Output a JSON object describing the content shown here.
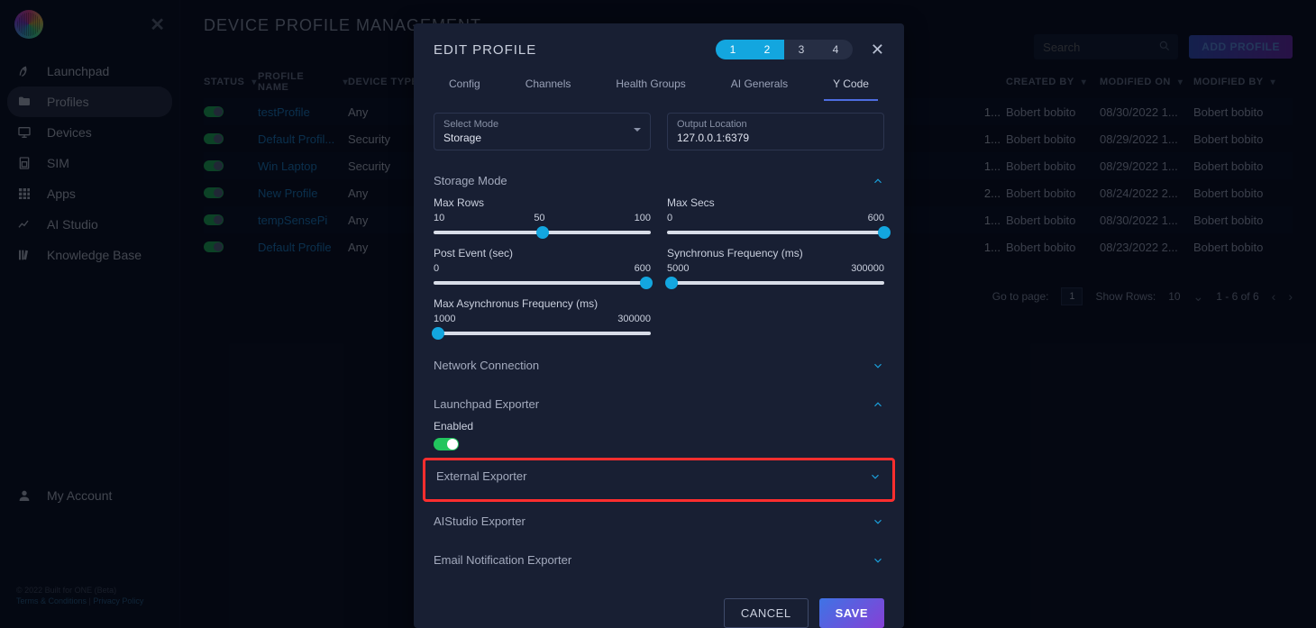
{
  "sidebar": {
    "items": [
      {
        "label": "Launchpad",
        "icon": "rocket-icon"
      },
      {
        "label": "Profiles",
        "icon": "folder-icon",
        "active": true
      },
      {
        "label": "Devices",
        "icon": "monitor-icon"
      },
      {
        "label": "SIM",
        "icon": "sim-icon"
      },
      {
        "label": "Apps",
        "icon": "grid-icon"
      },
      {
        "label": "AI Studio",
        "icon": "analytics-icon"
      },
      {
        "label": "Knowledge Base",
        "icon": "library-icon"
      }
    ],
    "account_label": "My Account",
    "footer_line1": "© 2022 Built for ONE (Beta)",
    "footer_terms": "Terms & Conditions",
    "footer_sep": " | ",
    "footer_privacy": "Privacy Policy"
  },
  "page": {
    "title": "DEVICE PROFILE MANAGEMENT",
    "search_placeholder": "Search",
    "add_profile_label": "ADD PROFILE"
  },
  "table": {
    "columns": {
      "status": "STATUS",
      "profile_name": "PROFILE NAME",
      "device_type": "DEVICE TYPE",
      "created_by": "CREATED BY",
      "modified_on": "MODIFIED ON",
      "modified_by": "MODIFIED BY"
    },
    "rows": [
      {
        "name": "testProfile",
        "device_type": "Any",
        "created_by": "Bobert bobito",
        "modified_on": "08/30/2022 1...",
        "modified_by": "Bobert bobito",
        "short": "1..."
      },
      {
        "name": "Default Profil...",
        "device_type": "Security",
        "created_by": "Bobert bobito",
        "modified_on": "08/29/2022 1...",
        "modified_by": "Bobert bobito",
        "short": "1..."
      },
      {
        "name": "Win Laptop",
        "device_type": "Security",
        "created_by": "Bobert bobito",
        "modified_on": "08/29/2022 1...",
        "modified_by": "Bobert bobito",
        "short": "1..."
      },
      {
        "name": "New Profile",
        "device_type": "Any",
        "created_by": "Bobert bobito",
        "modified_on": "08/24/2022 2...",
        "modified_by": "Bobert bobito",
        "short": "2..."
      },
      {
        "name": "tempSensePi",
        "device_type": "Any",
        "created_by": "Bobert bobito",
        "modified_on": "08/30/2022 1...",
        "modified_by": "Bobert bobito",
        "short": "1..."
      },
      {
        "name": "Default Profile",
        "device_type": "Any",
        "created_by": "Bobert bobito",
        "modified_on": "08/23/2022 2...",
        "modified_by": "Bobert bobito",
        "short": "1..."
      }
    ]
  },
  "pager": {
    "goto_label": "Go to page:",
    "goto_value": "1",
    "showrows_label": "Show Rows:",
    "showrows_value": "10",
    "range": "1 - 6 of 6"
  },
  "modal": {
    "title": "EDIT PROFILE",
    "steps": [
      "1",
      "2",
      "3",
      "4"
    ],
    "active_steps": [
      0,
      1
    ],
    "tabs": [
      "Config",
      "Channels",
      "Health Groups",
      "AI Generals",
      "Y Code"
    ],
    "active_tab": 4,
    "select_mode_label": "Select Mode",
    "select_mode_value": "Storage",
    "output_loc_label": "Output Location",
    "output_loc_value": "127.0.0.1:6379",
    "sections": {
      "storage_mode": {
        "title": "Storage Mode",
        "sliders": {
          "max_rows": {
            "label": "Max Rows",
            "min": "10",
            "mid": "50",
            "max": "100",
            "thumb_pct": 50
          },
          "max_secs": {
            "label": "Max Secs",
            "min": "0",
            "max": "600",
            "thumb_pct": 100
          },
          "post_event": {
            "label": "Post Event (sec)",
            "min": "0",
            "max": "600",
            "thumb_pct": 98
          },
          "sync_freq": {
            "label": "Synchronus Frequency (ms)",
            "min": "5000",
            "max": "300000",
            "thumb_pct": 2
          },
          "async_freq": {
            "label": "Max Asynchronus Frequency (ms)",
            "min": "1000",
            "max": "300000",
            "thumb_pct": 2
          }
        }
      },
      "network_connection": {
        "title": "Network Connection"
      },
      "launchpad_exporter": {
        "title": "Launchpad Exporter",
        "enabled_label": "Enabled"
      },
      "external_exporter": {
        "title": "External Exporter"
      },
      "aistudio_exporter": {
        "title": "AIStudio Exporter"
      },
      "email_exporter": {
        "title": "Email Notification Exporter"
      }
    },
    "cancel_label": "CANCEL",
    "save_label": "SAVE"
  }
}
